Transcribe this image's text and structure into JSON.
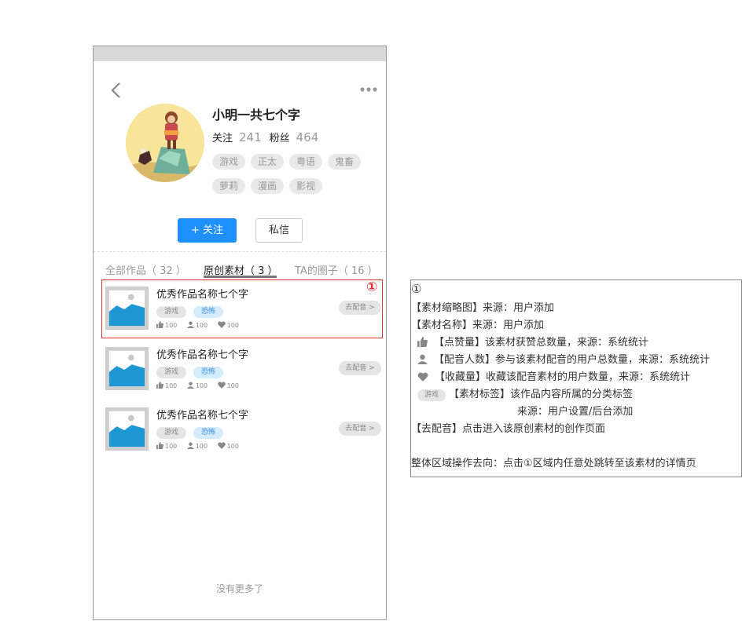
{
  "profile": {
    "name": "小明一共七个字",
    "follow_label": "关注",
    "follow_count": "241",
    "fans_label": "粉丝",
    "fans_count": "464",
    "tags": [
      "游戏",
      "正太",
      "粤语",
      "鬼畜",
      "萝莉",
      "漫画",
      "影视"
    ]
  },
  "actions": {
    "follow_button": "+ 关注",
    "message_button": "私信"
  },
  "tabs": [
    {
      "label": "全部作品（ 32 ）"
    },
    {
      "label": "原创素材（ 3 ）"
    },
    {
      "label": "TA的圈子（ 16 ）"
    }
  ],
  "items": [
    {
      "title": "优秀作品名称七个字",
      "tag1": "游戏",
      "tag2": "恐怖",
      "likes": "100",
      "dubbers": "100",
      "favorites": "100",
      "dub_button": "去配音 >"
    },
    {
      "title": "优秀作品名称七个字",
      "tag1": "游戏",
      "tag2": "恐怖",
      "likes": "100",
      "dubbers": "100",
      "favorites": "100",
      "dub_button": "去配音 >"
    },
    {
      "title": "优秀作品名称七个字",
      "tag1": "游戏",
      "tag2": "恐怖",
      "likes": "100",
      "dubbers": "100",
      "favorites": "100",
      "dub_button": "去配音 >"
    }
  ],
  "annotation_badge": "①",
  "no_more": "没有更多了",
  "notes": {
    "marker": "①",
    "thumbnail": "【素材缩略图】来源：用户添加",
    "name": "【素材名称】来源：用户添加",
    "likes": "【点赞量】该素材获赞总数量，来源：系统统计",
    "dubbers": "【配音人数】参与该素材配音的用户总数量，来源：系统统计",
    "favorites": "【收藏量】收藏该配音素材的用户数量，来源：系统统计",
    "tag_sample": "游戏",
    "tag_line1": "【素材标签】该作品内容所属的分类标签",
    "tag_line2": "来源：用户设置/后台添加",
    "dub": "【去配音】点击进入该原创素材的创作页面",
    "overall": "整体区域操作去向：点击①区域内任意处跳转至该素材的详情页"
  },
  "colors": {
    "accent": "#1e90ff",
    "highlight": "#e0302f",
    "tag_blue_bg": "#d4ecfb"
  }
}
